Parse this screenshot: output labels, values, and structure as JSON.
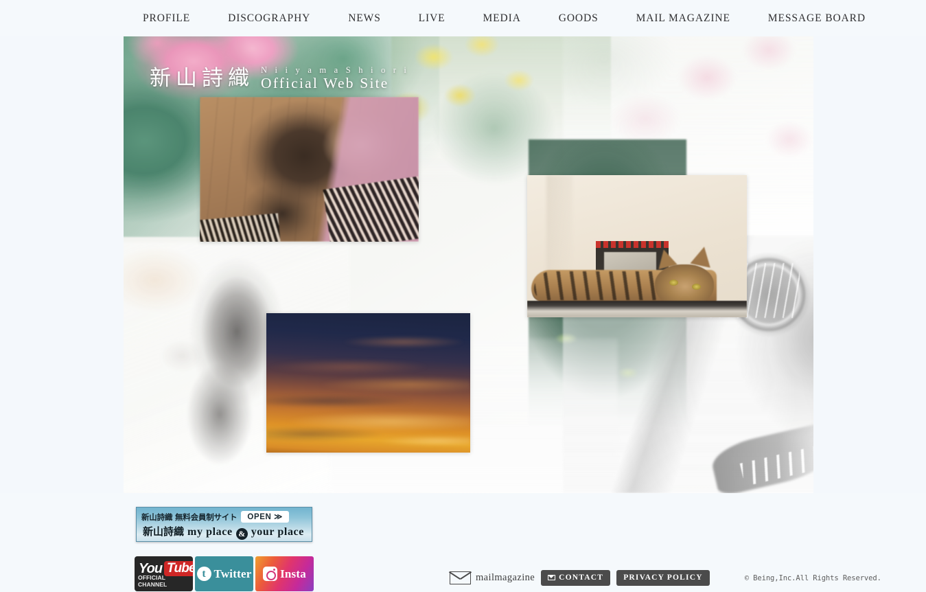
{
  "nav": {
    "items": [
      {
        "label": "PROFILE",
        "name": "nav-profile"
      },
      {
        "label": "DISCOGRAPHY",
        "name": "nav-discography"
      },
      {
        "label": "NEWS",
        "name": "nav-news"
      },
      {
        "label": "LIVE",
        "name": "nav-live"
      },
      {
        "label": "MEDIA",
        "name": "nav-media"
      },
      {
        "label": "GOODS",
        "name": "nav-goods"
      },
      {
        "label": "MAIL MAGAZINE",
        "name": "nav-mail-magazine"
      },
      {
        "label": "MESSAGE BOARD",
        "name": "nav-message-board"
      }
    ]
  },
  "hero": {
    "title_jp": "新山詩織",
    "title_romaji": "N i i y a m a   S h i o r i",
    "title_official": "Official Web Site",
    "photos": [
      {
        "name": "photo-cat-on-wood-floor",
        "caption": "tabby cat on wooden floor"
      },
      {
        "name": "photo-cat-on-shelf",
        "caption": "tabby cat lying on shelf"
      },
      {
        "name": "photo-sunset-sky",
        "caption": "orange sunset clouds"
      }
    ],
    "background_elements": [
      "pink azalea flowers",
      "yellow flowers",
      "pale cherry blossoms",
      "dark green foliage",
      "faded black-and-white cat",
      "faded acoustic guitar"
    ]
  },
  "footer": {
    "banner": {
      "headline_jp": "新山詩織 無料会員制サイト",
      "open_label": "OPEN ≫",
      "name_jp": "新山詩織",
      "tagline_a": "my place",
      "amp": "&",
      "tagline_b": "your place"
    },
    "social": {
      "youtube": {
        "you": "You",
        "tube": "Tube",
        "sub": "OFFICIAL CHANNEL"
      },
      "twitter": {
        "glyph": "t",
        "label": "Twitter"
      },
      "instagram": {
        "label": "Insta"
      }
    },
    "links": {
      "mailmagazine": "mailmagazine",
      "contact": "CONTACT",
      "privacy": "PRIVACY POLICY",
      "copyright": "© Being,Inc.All Rights Reserved."
    }
  },
  "colors": {
    "page_bg": "#f4f8fc",
    "nav_bg": "#f5f9fc",
    "nav_text": "#2f2f31",
    "banner_teal": "#72b4cf",
    "youtube_red": "#cf2726",
    "twitter_teal": "#3a8f9b",
    "dark_button": "#4b4b4b"
  }
}
